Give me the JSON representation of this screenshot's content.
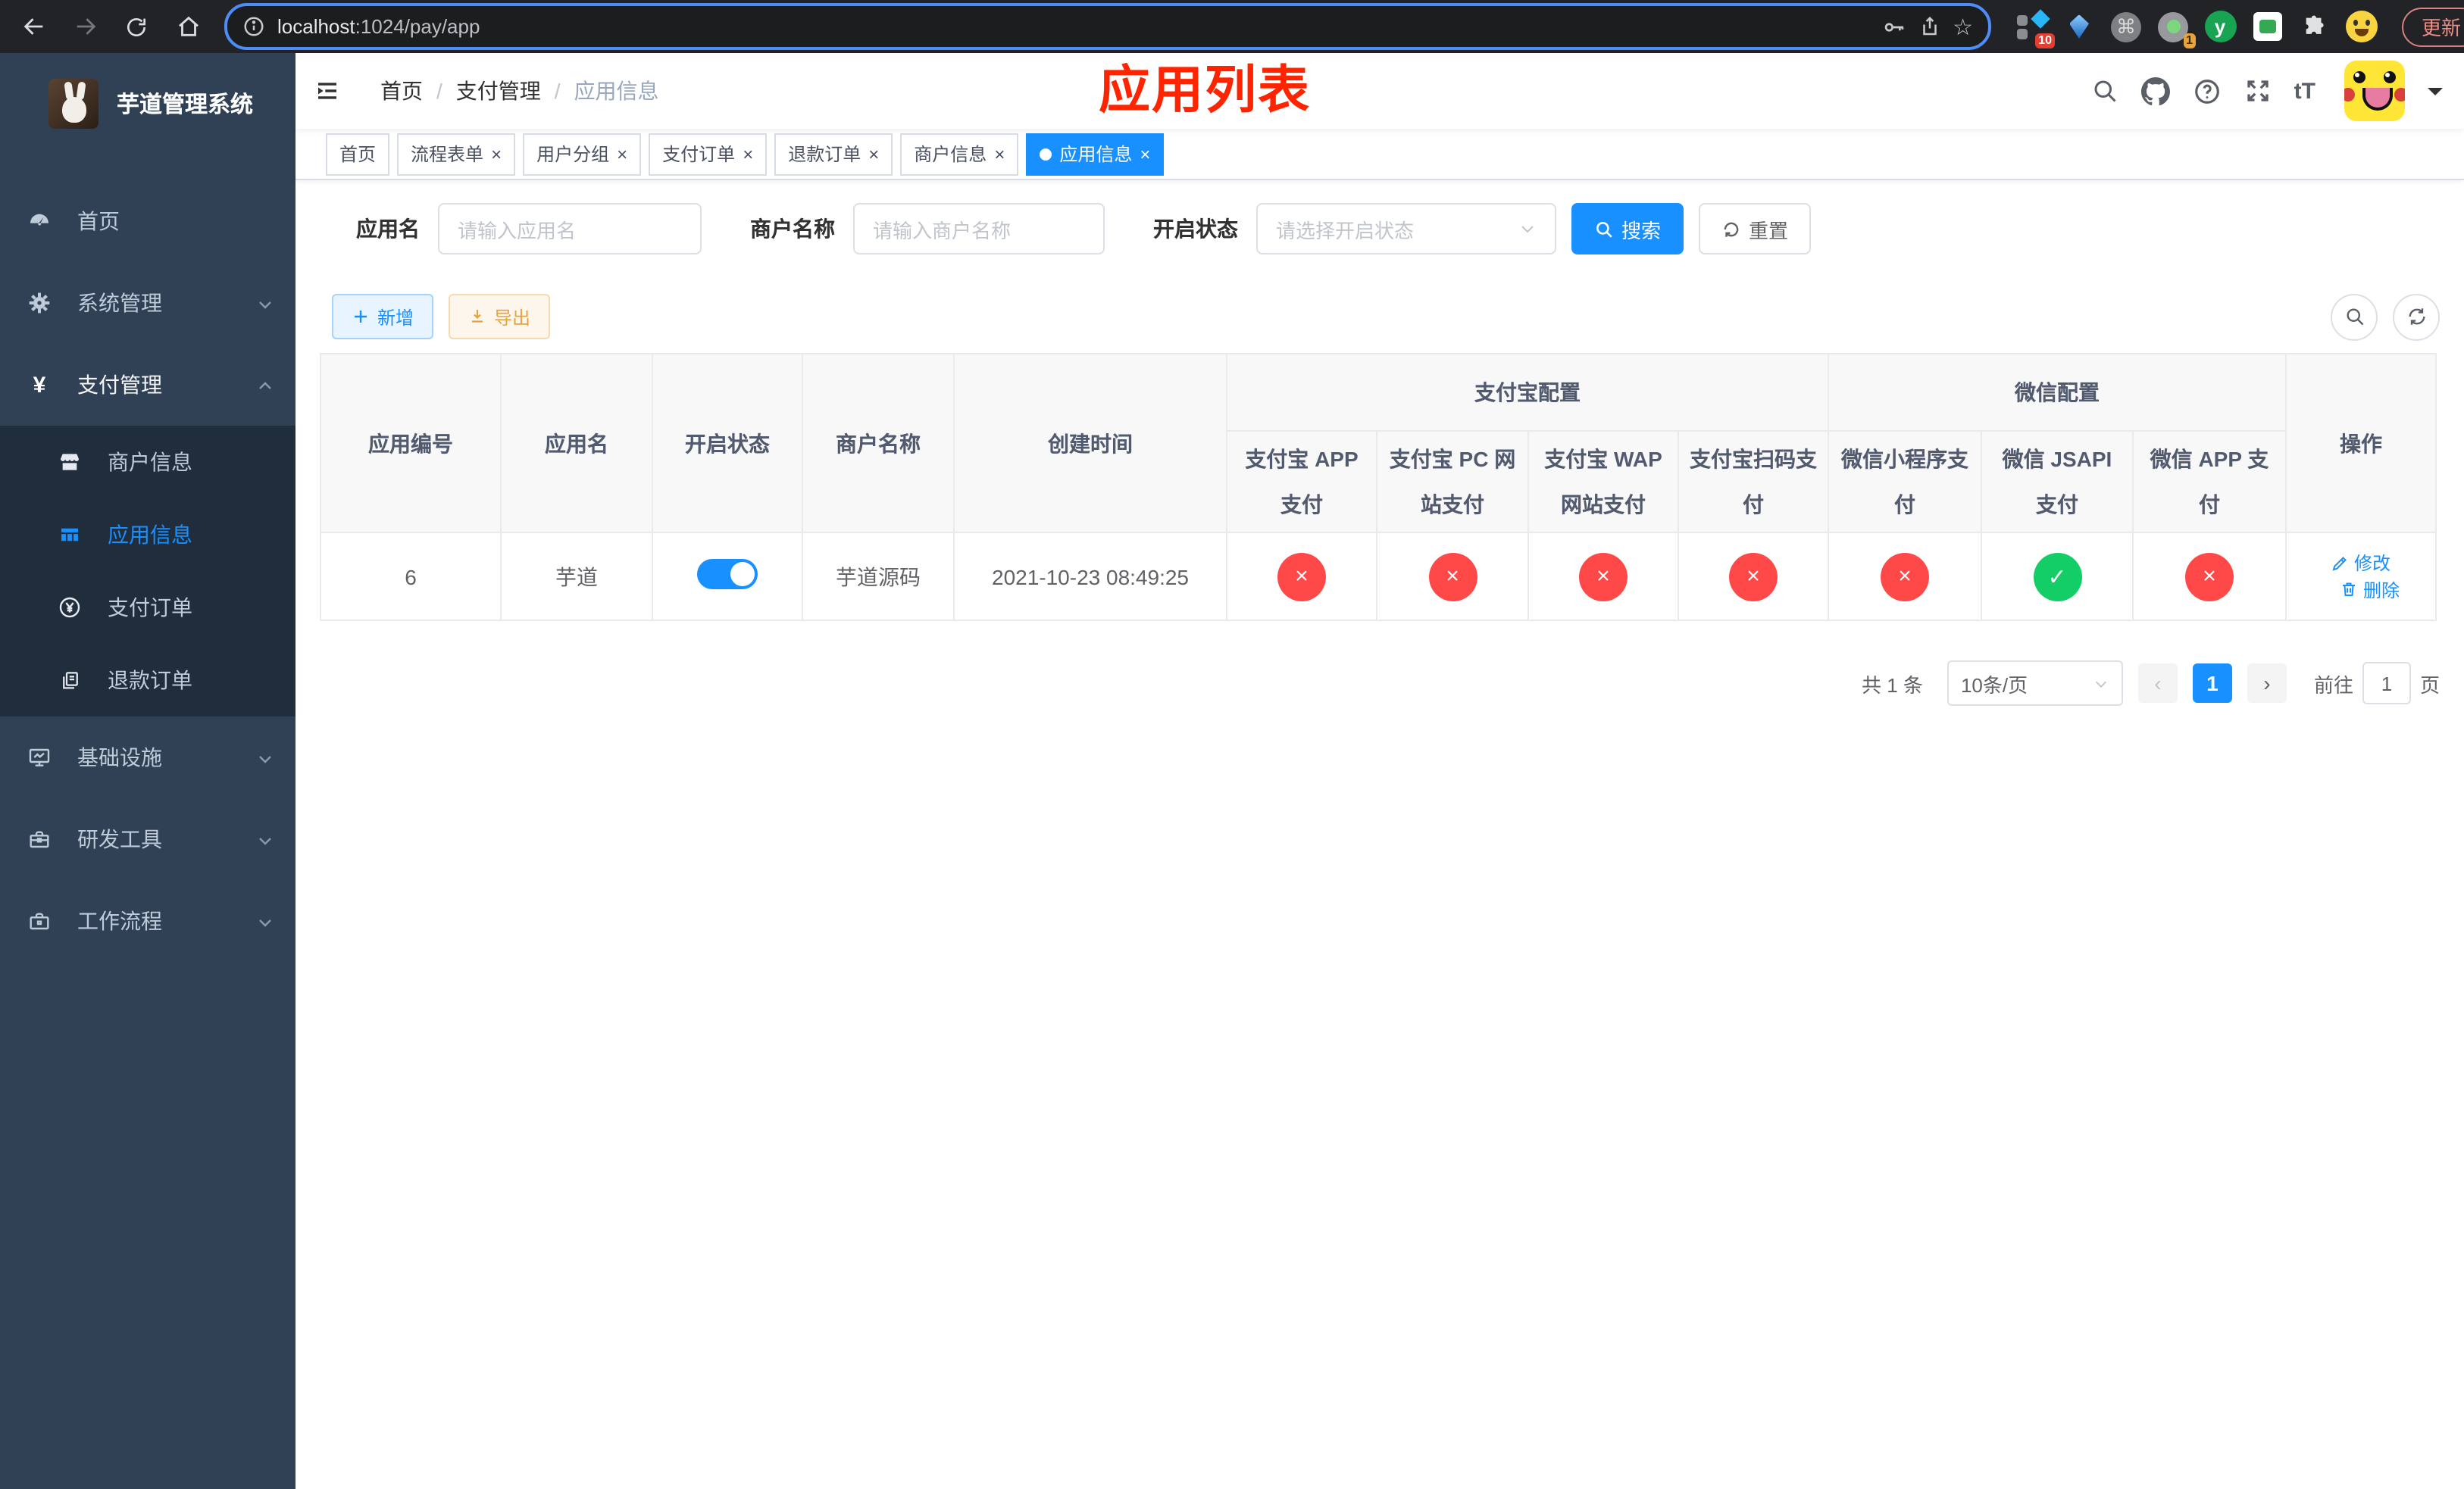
{
  "colors": {
    "accent": "#1890ff",
    "success": "#13ce66",
    "danger": "#ff4949",
    "annotation": "#ff2400",
    "sidebar_bg": "#304156",
    "submenu_bg": "#1f2d3d"
  },
  "glyphs": {
    "close": "×",
    "command": "⌘",
    "yen": "¥",
    "prev": "‹",
    "next": "›",
    "star": "☆",
    "sep": "/",
    "font_size": "tT",
    "check": "✓",
    "cross": "×"
  },
  "browser": {
    "url_host": "localhost",
    "url_path": ":1024/pay/app",
    "ext_badge_blue": "10",
    "ext_badge_orange": "1",
    "ext_green_letter": "y",
    "update_button": "更新"
  },
  "sidebar": {
    "title": "芋道管理系统",
    "items": [
      {
        "label": "首页"
      },
      {
        "label": "系统管理"
      },
      {
        "label": "支付管理"
      },
      {
        "label": "基础设施"
      },
      {
        "label": "研发工具"
      },
      {
        "label": "工作流程"
      }
    ],
    "submenu": [
      {
        "label": "商户信息"
      },
      {
        "label": "应用信息"
      },
      {
        "label": "支付订单"
      },
      {
        "label": "退款订单"
      }
    ]
  },
  "navbar": {
    "breadcrumb": [
      "首页",
      "支付管理",
      "应用信息"
    ],
    "annotation": "应用列表"
  },
  "tabs": [
    {
      "label": "首页"
    },
    {
      "label": "流程表单"
    },
    {
      "label": "用户分组"
    },
    {
      "label": "支付订单"
    },
    {
      "label": "退款订单"
    },
    {
      "label": "商户信息"
    },
    {
      "label": "应用信息"
    }
  ],
  "filters": {
    "app_name_label": "应用名",
    "app_name_placeholder": "请输入应用名",
    "merchant_label": "商户名称",
    "merchant_placeholder": "请输入商户名称",
    "status_label": "开启状态",
    "status_placeholder": "请选择开启状态",
    "search": "搜索",
    "reset": "重置"
  },
  "toolbar": {
    "add": "新增",
    "export": "导出"
  },
  "table": {
    "groups": {
      "alipay": "支付宝配置",
      "wechat": "微信配置"
    },
    "columns": [
      "应用编号",
      "应用名",
      "开启状态",
      "商户名称",
      "创建时间",
      "支付宝 APP 支付",
      "支付宝 PC 网站支付",
      "支付宝 WAP 网站支付",
      "支付宝扫码支付",
      "微信小程序支付",
      "微信 JSAPI 支付",
      "微信 APP 支付",
      "操作"
    ],
    "row": {
      "id": "6",
      "name": "芋道",
      "merchant": "芋道源码",
      "created": "2021-10-23 08:49:25",
      "statuses": [
        "×",
        "×",
        "×",
        "×",
        "×",
        "✓",
        "×"
      ],
      "edit": "修改",
      "delete": "删除"
    }
  },
  "pagination": {
    "total": "共 1 条",
    "page_size": "10条/页",
    "current": "1",
    "goto": "前往",
    "goto_value": "1",
    "unit": "页"
  }
}
